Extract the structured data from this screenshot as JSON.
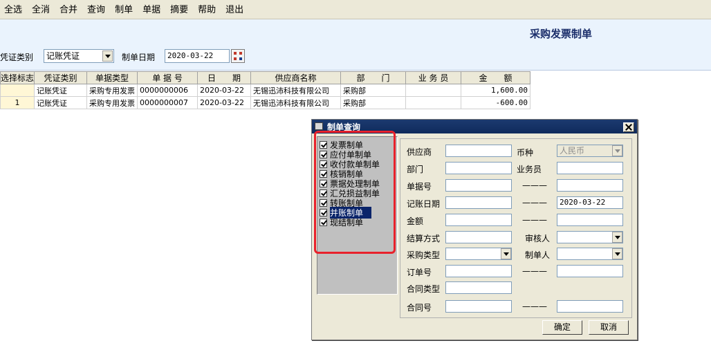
{
  "toolbar": [
    "全选",
    "全消",
    "合并",
    "查询",
    "制单",
    "单据",
    "摘要",
    "帮助",
    "退出"
  ],
  "header": {
    "title": "采购发票制单",
    "voucher_type_label": "凭证类别",
    "voucher_type_value": "记账凭证",
    "date_label": "制单日期",
    "date_value": "2020-03-22"
  },
  "grid": {
    "columns": [
      "选择标志",
      "凭证类别",
      "单据类型",
      "单 据 号",
      "日　　期",
      "供应商名称",
      "部　　门",
      "业 务 员",
      "金　　额"
    ],
    "rows": [
      [
        "",
        "记账凭证",
        "采购专用发票",
        "0000000006",
        "2020-03-22",
        "无锡迅沛科技有限公司",
        "采购部",
        "",
        "1,600.00"
      ],
      [
        "1",
        "记账凭证",
        "采购专用发票",
        "0000000007",
        "2020-03-22",
        "无锡迅沛科技有限公司",
        "采购部",
        "",
        "-600.00"
      ]
    ]
  },
  "dialog": {
    "title": "制单查询",
    "doc_types": [
      "发票制单",
      "应付单制单",
      "收付款单制单",
      "核销制单",
      "票据处理制单",
      "汇兑损益制单",
      "转账制单",
      "并账制单",
      "现结制单"
    ],
    "selected_doc_type": "并账制单",
    "fields": {
      "supplier": "供应商",
      "currency": "币种",
      "currency_value": "人民币",
      "department": "部门",
      "salesman": "业务员",
      "doc_no": "单据号",
      "book_date": "记账日期",
      "book_date_to": "2020-03-22",
      "amount": "金额",
      "settle_method": "结算方式",
      "auditor": "审核人",
      "purchase_type": "采购类型",
      "maker": "制单人",
      "order_no": "订单号",
      "contract_type": "合同类型",
      "contract_no": "合同号",
      "range_sep": "———"
    },
    "ok": "确定",
    "cancel": "取消"
  },
  "colors": {
    "highlight_frame": "#e8212b",
    "dialog_title_bg": "#0f2a5c",
    "selection_bg": "#0a246a"
  }
}
